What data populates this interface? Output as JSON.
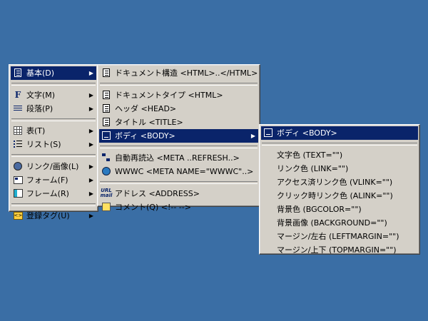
{
  "menu1": {
    "items": [
      {
        "label": "基本(D)",
        "icon": "document-icon"
      },
      {
        "label": "文字(M)",
        "icon": "font-icon"
      },
      {
        "label": "段落(P)",
        "icon": "paragraph-icon"
      },
      {
        "label": "表(T)",
        "icon": "table-icon"
      },
      {
        "label": "リスト(S)",
        "icon": "list-icon"
      },
      {
        "label": "リンク/画像(L)",
        "icon": "link-icon"
      },
      {
        "label": "フォーム(F)",
        "icon": "form-icon"
      },
      {
        "label": "フレーム(R)",
        "icon": "frame-icon"
      },
      {
        "label": "登録タグ(U)",
        "icon": "registered-tag-icon"
      }
    ]
  },
  "menu2": {
    "items": [
      {
        "label": "ドキュメント構造 <HTML>..</HTML>",
        "icon": "document-icon"
      },
      {
        "label": "ドキュメントタイプ <HTML>",
        "icon": "document-icon"
      },
      {
        "label": "ヘッダ <HEAD>",
        "icon": "document-icon"
      },
      {
        "label": "タイトル <TITLE>",
        "icon": "document-icon"
      },
      {
        "label": "ボディ <BODY>",
        "icon": "body-icon"
      },
      {
        "label": "自動再読込 <META ..REFRESH..>",
        "icon": "refresh-icon"
      },
      {
        "label": "WWWC <META NAME=\"WWWC\"..>",
        "icon": "globe-icon"
      },
      {
        "label": "アドレス <ADDRESS>",
        "icon": "url-mail-icon"
      },
      {
        "label": "コメント(Q) <!--   -->",
        "icon": "comment-icon"
      }
    ]
  },
  "menu3": {
    "items": [
      {
        "label": "ボディ <BODY>",
        "icon": "body-icon"
      },
      {
        "label": "文字色 (TEXT=\"\")"
      },
      {
        "label": "リンク色 (LINK=\"\")"
      },
      {
        "label": "アクセス済リンク色 (VLINK=\"\")"
      },
      {
        "label": "クリック時リンク色 (ALINK=\"\")"
      },
      {
        "label": "背景色 (BGCOLOR=\"\")"
      },
      {
        "label": "背景画像 (BACKGROUND=\"\")"
      },
      {
        "label": "マージン/左右 (LEFTMARGIN=\"\")"
      },
      {
        "label": "マージン/上下 (TOPMARGIN=\"\")"
      }
    ]
  },
  "colors": {
    "desktop": "#3a6ea5",
    "menu": "#d4d0c8",
    "highlight": "#0a246a"
  },
  "submenu_arrow": "▶"
}
